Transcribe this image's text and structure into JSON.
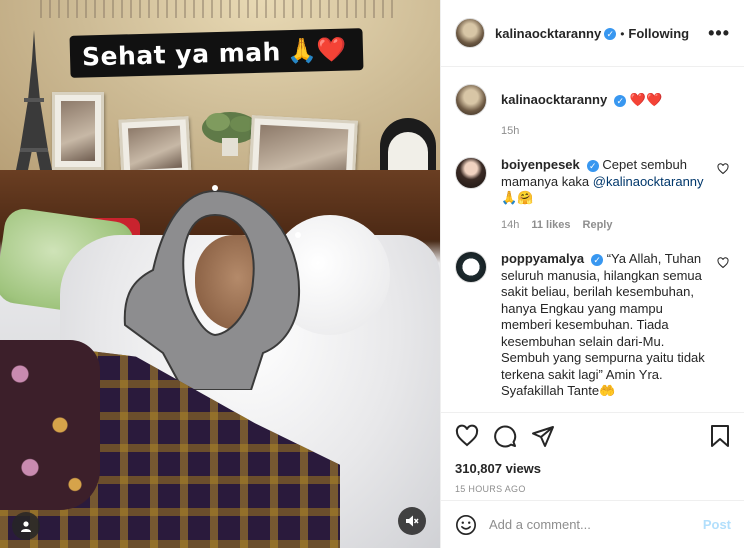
{
  "story": {
    "caption_text": "Sehat ya mah",
    "caption_emoji": "🙏❤️"
  },
  "header": {
    "username": "kalinaocktaranny",
    "separator": "•",
    "follow_status": "Following",
    "more_label": "•••"
  },
  "caption": {
    "username": "kalinaocktaranny",
    "text": "❤️❤️",
    "time": "15h"
  },
  "comments": [
    {
      "username": "boiyenpesek",
      "text": "Cepet sembuh mamanya kaka",
      "mention": "@kalinaocktaranny",
      "emoji": "🙏🤗",
      "time": "14h",
      "likes": "11 likes",
      "reply": "Reply"
    },
    {
      "username": "poppyamalya",
      "text": "“Ya Allah, Tuhan seluruh manusia, hilangkan semua sakit beliau, berilah kesembuhan, hanya Engkau yang mampu memberi kesembuhan. Tiada kesembuhan selain dari-Mu. Sembuh yang sempurna yaitu tidak terkena sakit lagi” Amin Yra. Syafakillah Tante🤲"
    }
  ],
  "actions": {
    "views": "310,807 views",
    "timestamp": "15 HOURS AGO"
  },
  "add_comment": {
    "placeholder": "Add a comment...",
    "post_label": "Post"
  },
  "colors": {
    "verified": "#3897f0",
    "post_disabled": "#b2dffc",
    "muted": "#8e8e8e"
  }
}
